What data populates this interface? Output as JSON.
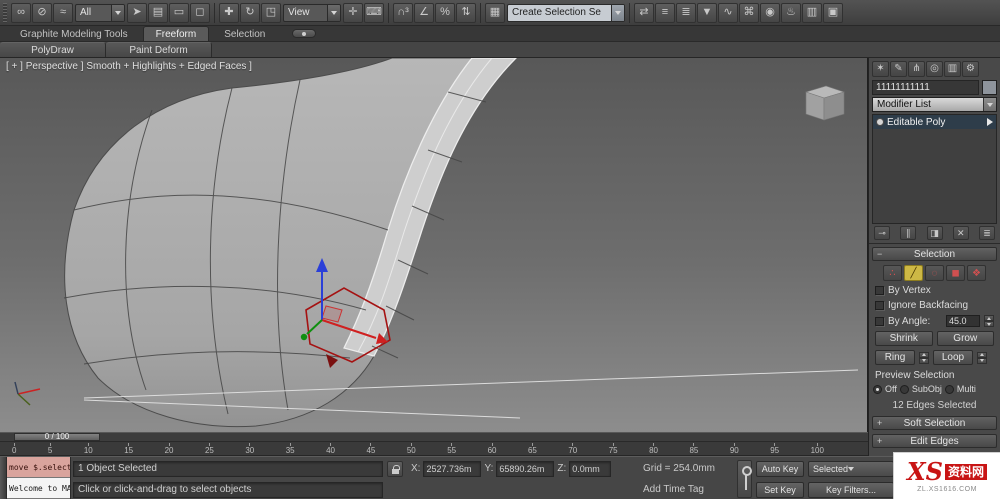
{
  "colors": {
    "selection_red": "#a51212",
    "gizmo_x_red": "#d02020",
    "gizmo_y_green": "#0f8f0f",
    "gizmo_z_blue": "#2a3fd8",
    "highlight_edge": "#ededed",
    "watermark_red": "#c81414",
    "active_subobject_yellow": "#cdb845"
  },
  "main_toolbar": {
    "filter_dropdown": "All",
    "reference_dropdown": "View",
    "named_selection_field": "Create Selection Se",
    "groups": {
      "link": [
        {
          "name": "select-and-link-icon",
          "glyph": "∞"
        },
        {
          "name": "unlink-selection-icon",
          "glyph": "⊘"
        },
        {
          "name": "bind-to-spacewarp-icon",
          "glyph": "≈"
        }
      ],
      "selection_tools": [
        {
          "name": "select-object-icon",
          "glyph": "➤"
        },
        {
          "name": "select-by-name-icon",
          "glyph": "▤"
        },
        {
          "name": "rectangular-region-icon",
          "glyph": "▭"
        },
        {
          "name": "window-crossing-icon",
          "glyph": "◻"
        }
      ],
      "transform_tools": [
        {
          "name": "select-and-move-icon",
          "glyph": "✚"
        },
        {
          "name": "select-and-rotate-icon",
          "glyph": "↻"
        },
        {
          "name": "select-and-scale-icon",
          "glyph": "◳"
        }
      ],
      "manipulate": [
        {
          "name": "select-and-manipulate-icon",
          "glyph": "✛"
        },
        {
          "name": "keyboard-override-icon",
          "glyph": "⌨"
        }
      ],
      "snaps": [
        {
          "name": "snap-toggle-3d-icon",
          "glyph": "∩³"
        },
        {
          "name": "angle-snap-icon",
          "glyph": "∠"
        },
        {
          "name": "percent-snap-icon",
          "glyph": "%"
        },
        {
          "name": "spinner-snap-icon",
          "glyph": "⇅"
        }
      ],
      "named_sets": [
        {
          "name": "edit-named-selection-sets-icon",
          "glyph": "▦"
        }
      ],
      "right_tools": [
        {
          "name": "mirror-icon",
          "glyph": "⇄"
        },
        {
          "name": "align-icon",
          "glyph": "≡"
        },
        {
          "name": "layer-manager-icon",
          "glyph": "≣"
        },
        {
          "name": "graphite-ribbon-toggle-icon",
          "glyph": "▼"
        },
        {
          "name": "curve-editor-icon",
          "glyph": "∿"
        },
        {
          "name": "schematic-view-icon",
          "glyph": "⌘"
        },
        {
          "name": "material-editor-icon",
          "glyph": "◉"
        },
        {
          "name": "render-setup-icon",
          "glyph": "♨"
        },
        {
          "name": "rendered-frame-icon",
          "glyph": "▥"
        },
        {
          "name": "render-production-icon",
          "glyph": "▣"
        }
      ]
    }
  },
  "ribbon": {
    "tabs": [
      "Graphite Modeling Tools",
      "Freeform",
      "Selection"
    ],
    "active_tab": "Freeform",
    "subtabs": [
      "PolyDraw",
      "Paint Deform"
    ]
  },
  "viewport": {
    "label": "[ + ] Perspective ] Smooth + Highlights + Edged Faces ]"
  },
  "command_panel": {
    "tabs": [
      {
        "name": "create-tab-icon",
        "glyph": "✶"
      },
      {
        "name": "modify-tab-icon",
        "glyph": "✎"
      },
      {
        "name": "hierarchy-tab-icon",
        "glyph": "⋔"
      },
      {
        "name": "motion-tab-icon",
        "glyph": "◎"
      },
      {
        "name": "display-tab-icon",
        "glyph": "▥"
      },
      {
        "name": "utilities-tab-icon",
        "glyph": "⚙"
      }
    ],
    "object_name": "11111111111",
    "modifier_list_label": "Modifier List",
    "stack_items": [
      {
        "label": "Editable Poly"
      }
    ],
    "stack_tools": [
      {
        "name": "pin-stack-icon",
        "glyph": "⊸"
      },
      {
        "name": "show-end-result-icon",
        "glyph": "∥"
      },
      {
        "name": "make-unique-icon",
        "glyph": "◨"
      },
      {
        "name": "remove-modifier-icon",
        "glyph": "✕"
      },
      {
        "name": "configure-modifier-sets-icon",
        "glyph": "≣"
      }
    ],
    "selection_rollout": {
      "title": "Selection",
      "collapse_indicator": "−",
      "subobject_icons": [
        {
          "name": "vertex-mode-icon",
          "glyph": "∴"
        },
        {
          "name": "edge-mode-icon",
          "glyph": "╱",
          "active": true
        },
        {
          "name": "border-mode-icon",
          "glyph": "◌"
        },
        {
          "name": "polygon-mode-icon",
          "glyph": "◼"
        },
        {
          "name": "element-mode-icon",
          "glyph": "❖"
        }
      ],
      "by_vertex_label": "By Vertex",
      "ignore_backfacing_label": "Ignore Backfacing",
      "by_angle_label": "By Angle:",
      "by_angle_value": "45.0",
      "shrink_label": "Shrink",
      "grow_label": "Grow",
      "ring_label": "Ring",
      "loop_label": "Loop",
      "preview_label": "Preview Selection",
      "preview_options": [
        "Off",
        "SubObj",
        "Multi"
      ],
      "preview_active": "Off",
      "status_text": "12 Edges Selected"
    },
    "soft_selection_title": "Soft Selection",
    "edit_edges_title": "Edit Edges",
    "collapsed_indicator": "+"
  },
  "timeline": {
    "slider_label": "0 / 100",
    "ticks": [
      "0",
      "5",
      "10",
      "15",
      "20",
      "25",
      "30",
      "35",
      "40",
      "45",
      "50",
      "55",
      "60",
      "65",
      "70",
      "75",
      "80",
      "85",
      "90",
      "95",
      "100"
    ]
  },
  "status_bar": {
    "listener_top": "move $.selecte",
    "listener_bottom": "Welcome to MAX",
    "selection_status": "1 Object Selected",
    "prompt": "Click or click-and-drag to select objects",
    "x_label": "X:",
    "x_value": "2527.736m",
    "y_label": "Y:",
    "y_value": "65890.26m",
    "z_label": "Z:",
    "z_value": "0.0mm",
    "grid_label": "Grid = 254.0mm",
    "add_time_tag": "Add Time Tag",
    "auto_key_label": "Auto Key",
    "set_key_label": "Set Key",
    "selected_dropdown": "Selected",
    "key_filters_label": "Key Filters..."
  },
  "watermark": {
    "brand": "XS",
    "brand_cn": "资料网",
    "url": "ZL.XS1616.COM"
  }
}
